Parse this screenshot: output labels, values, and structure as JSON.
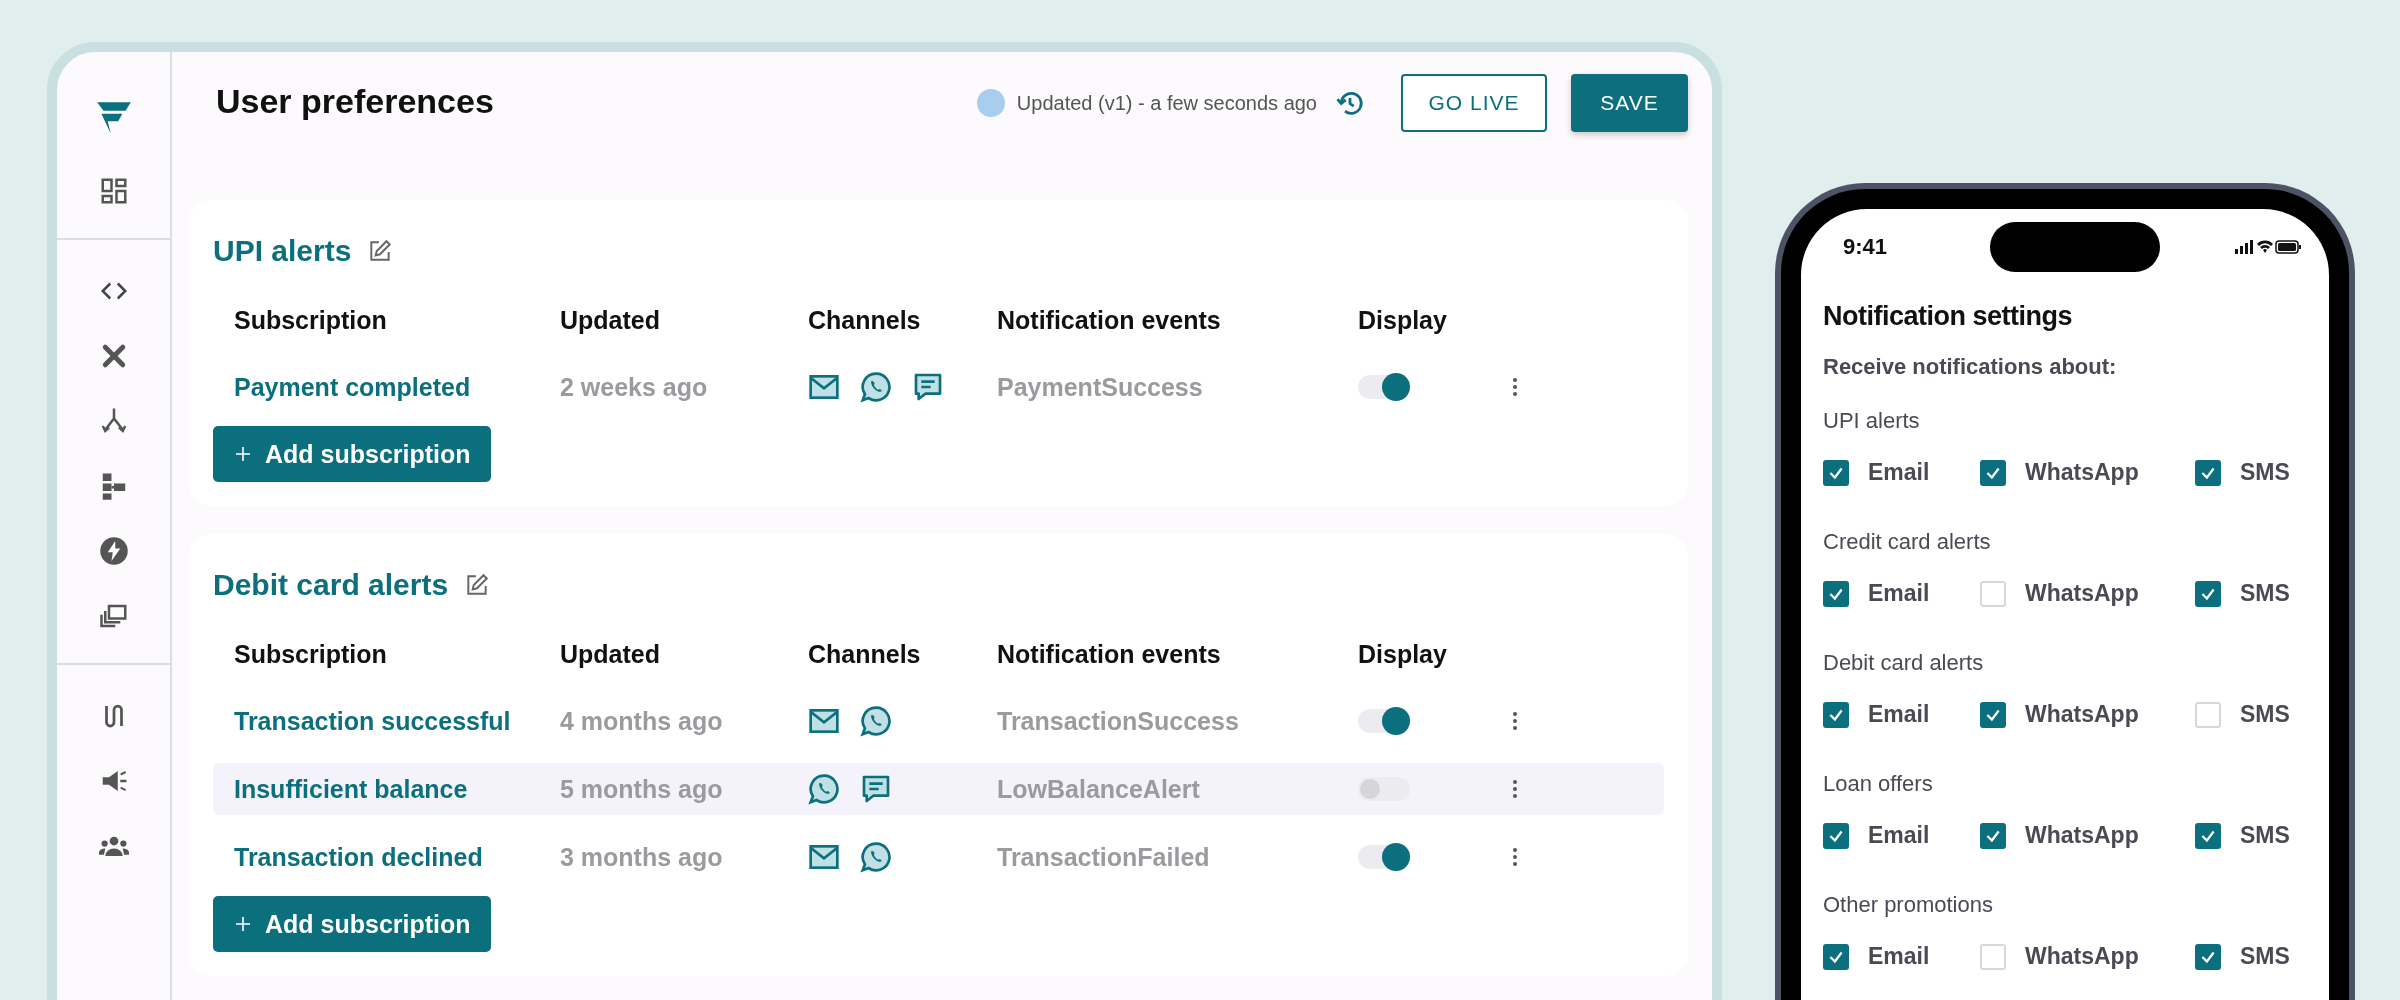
{
  "header": {
    "title": "User preferences",
    "status": "Updated (v1) - a few seconds ago",
    "buttons": [
      {
        "label": "GO LIVE",
        "kind": "outline"
      },
      {
        "label": "SAVE",
        "kind": "primary"
      }
    ]
  },
  "sections": [
    {
      "title": "UPI alerts",
      "columns": [
        "Subscription",
        "Updated",
        "Channels",
        "Notification events",
        "Display"
      ],
      "rows": [
        {
          "subscription": "Payment completed",
          "updated": "2 weeks ago",
          "channels": [
            {
              "kind": "email"
            },
            {
              "kind": "whatsapp"
            },
            {
              "kind": "sms"
            }
          ],
          "event": "PaymentSuccess",
          "on": true,
          "selected": false
        }
      ],
      "add_button": "Add subscription"
    },
    {
      "title": "Debit card alerts",
      "columns": [
        "Subscription",
        "Updated",
        "Channels",
        "Notification events",
        "Display"
      ],
      "rows": [
        {
          "subscription": "Transaction successful",
          "updated": "4 months ago",
          "channels": [
            {
              "kind": "email"
            },
            {
              "kind": "whatsapp"
            }
          ],
          "event": "TransactionSuccess",
          "on": true,
          "selected": false
        },
        {
          "subscription": "Insufficient balance",
          "updated": "5 months ago",
          "channels": [
            {
              "kind": "whatsapp"
            },
            {
              "kind": "sms"
            }
          ],
          "event": "LowBalanceAlert",
          "on": false,
          "selected": true
        },
        {
          "subscription": "Transaction declined",
          "updated": "3 months ago",
          "channels": [
            {
              "kind": "email"
            },
            {
              "kind": "whatsapp"
            }
          ],
          "event": "TransactionFailed",
          "on": true,
          "selected": false
        }
      ],
      "add_button": "Add subscription"
    }
  ],
  "phone": {
    "time": "9:41",
    "title": "Notification settings",
    "subtitle": "Receive notifications about:",
    "groups": [
      {
        "title": "UPI alerts",
        "options": [
          {
            "label": "Email",
            "checked": true
          },
          {
            "label": "WhatsApp",
            "checked": true
          },
          {
            "label": "SMS",
            "checked": true
          }
        ]
      },
      {
        "title": "Credit card alerts",
        "options": [
          {
            "label": "Email",
            "checked": true
          },
          {
            "label": "WhatsApp",
            "checked": false
          },
          {
            "label": "SMS",
            "checked": true
          }
        ]
      },
      {
        "title": "Debit card alerts",
        "options": [
          {
            "label": "Email",
            "checked": true
          },
          {
            "label": "WhatsApp",
            "checked": true
          },
          {
            "label": "SMS",
            "checked": false
          }
        ]
      },
      {
        "title": "Loan offers",
        "options": [
          {
            "label": "Email",
            "checked": true
          },
          {
            "label": "WhatsApp",
            "checked": true
          },
          {
            "label": "SMS",
            "checked": true
          }
        ]
      },
      {
        "title": "Other promotions",
        "options": [
          {
            "label": "Email",
            "checked": true
          },
          {
            "label": "WhatsApp",
            "checked": false
          },
          {
            "label": "SMS",
            "checked": true
          }
        ]
      }
    ]
  }
}
